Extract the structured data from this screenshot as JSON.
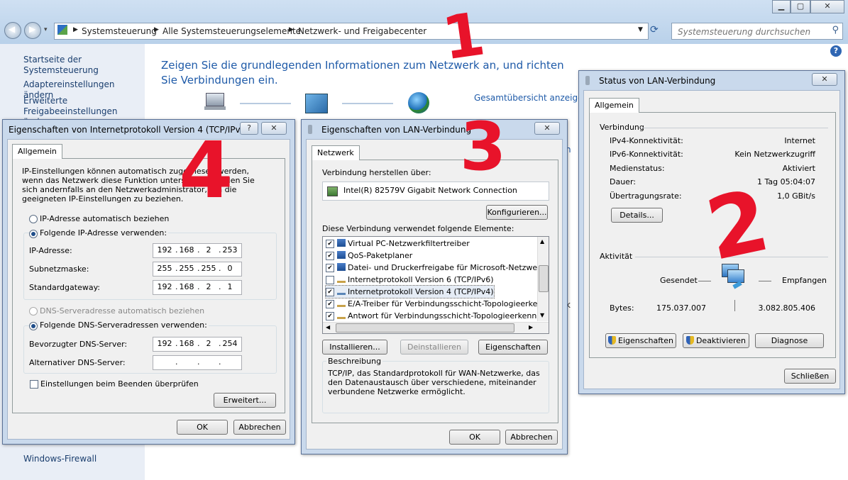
{
  "explorer": {
    "breadcrumb": [
      "Systemsteuerung",
      "Alle Systemsteuerungselemente",
      "Netzwerk- und Freigabecenter"
    ],
    "search_placeholder": "Systemsteuerung durchsuchen",
    "sidebar": [
      "Startseite der Systemsteuerung",
      "Adaptereinstellungen ändern",
      "Erweiterte Freigabeeinstellungen ändern",
      "Windows-Firewall"
    ],
    "heading": "Zeigen Sie die grundlegenden Informationen zum Netzwerk an, und richten Sie Verbindungen ein.",
    "overview_link": "Gesamtübersicht anzeigen"
  },
  "ipv4_dialog": {
    "title": "Eigenschaften von Internetprotokoll Version 4 (TCP/IPv4)",
    "tab": "Allgemein",
    "description": "IP-Einstellungen können automatisch zugewiesen werden, wenn das Netzwerk diese Funktion unterstützt. Wenden Sie sich andernfalls an den Netzwerkadministrator, um die geeigneten IP-Einstellungen zu beziehen.",
    "radio_auto_ip": "IP-Adresse automatisch beziehen",
    "radio_manual_ip": "Folgende IP-Adresse verwenden:",
    "ip_label": "IP-Adresse:",
    "ip": [
      "192",
      "168",
      "2",
      "253"
    ],
    "subnet_label": "Subnetzmaske:",
    "subnet": [
      "255",
      "255",
      "255",
      "0"
    ],
    "gateway_label": "Standardgateway:",
    "gateway": [
      "192",
      "168",
      "2",
      "1"
    ],
    "radio_auto_dns": "DNS-Serveradresse automatisch beziehen",
    "radio_manual_dns": "Folgende DNS-Serveradressen verwenden:",
    "dns1_label": "Bevorzugter DNS-Server:",
    "dns1": [
      "192",
      "168",
      "2",
      "254"
    ],
    "dns2_label": "Alternativer DNS-Server:",
    "validate_label": "Einstellungen beim Beenden überprüfen",
    "advanced_button": "Erweitert...",
    "ok_button": "OK",
    "cancel_button": "Abbrechen"
  },
  "lan_props_dialog": {
    "title": "Eigenschaften von LAN-Verbindung",
    "tab": "Netzwerk",
    "connect_using_label": "Verbindung herstellen über:",
    "adapter": "Intel(R) 82579V Gigabit Network Connection",
    "configure_button": "Konfigurieren...",
    "items_label": "Diese Verbindung verwendet folgende Elemente:",
    "items": [
      {
        "label": "Virtual PC-Netzwerkfiltertreiber",
        "checked": true
      },
      {
        "label": "QoS-Paketplaner",
        "checked": true
      },
      {
        "label": "Datei- und Druckerfreigabe für Microsoft-Netzwerke",
        "checked": true
      },
      {
        "label": "Internetprotokoll Version 6 (TCP/IPv6)",
        "checked": false
      },
      {
        "label": "Internetprotokoll Version 4 (TCP/IPv4)",
        "checked": true
      },
      {
        "label": "E/A-Treiber für Verbindungsschicht-Topologieerkennung",
        "checked": true
      },
      {
        "label": "Antwort für Verbindungsschicht-Topologieerkennung",
        "checked": true
      }
    ],
    "install_button": "Installieren...",
    "uninstall_button": "Deinstallieren",
    "properties_button": "Eigenschaften",
    "description_title": "Beschreibung",
    "description": "TCP/IP, das Standardprotokoll für WAN-Netzwerke, das den Datenaustausch über verschiedene, miteinander verbundene Netzwerke ermöglicht.",
    "ok_button": "OK",
    "cancel_button": "Abbrechen"
  },
  "lan_status_dialog": {
    "title": "Status von LAN-Verbindung",
    "tab": "Allgemein",
    "connection_label": "Verbindung",
    "rows": [
      {
        "label": "IPv4-Konnektivität:",
        "value": "Internet"
      },
      {
        "label": "IPv6-Konnektivität:",
        "value": "Kein Netzwerkzugriff"
      },
      {
        "label": "Medienstatus:",
        "value": "Aktiviert"
      },
      {
        "label": "Dauer:",
        "value": "1 Tag 05:04:07"
      },
      {
        "label": "Übertragungsrate:",
        "value": "1,0 GBit/s"
      }
    ],
    "details_button": "Details...",
    "activity_label": "Aktivität",
    "sent_label": "Gesendet",
    "received_label": "Empfangen",
    "bytes_label": "Bytes:",
    "bytes_sent": "175.037.007",
    "bytes_received": "3.082.805.406",
    "properties_button": "Eigenschaften",
    "disable_button": "Deaktivieren",
    "diagnose_button": "Diagnose",
    "close_button": "Schließen"
  },
  "annotations": [
    "1",
    "2",
    "3",
    "4"
  ]
}
